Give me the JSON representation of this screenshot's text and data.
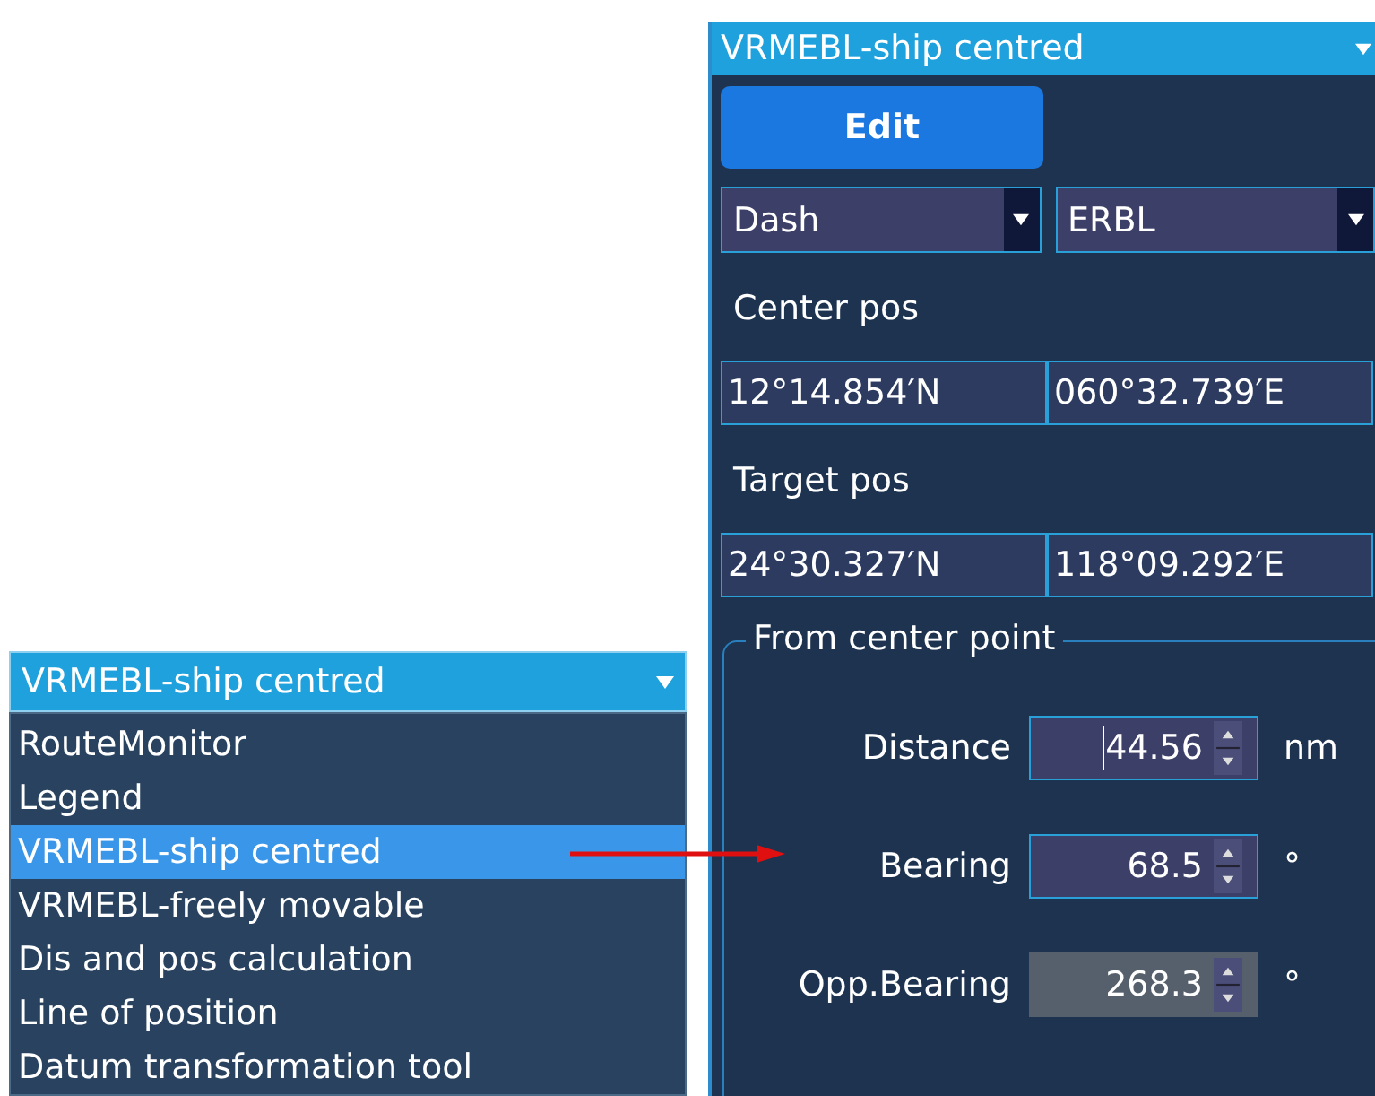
{
  "menu": {
    "value": "VRMEBL-ship centred",
    "options": [
      {
        "label": "RouteMonitor",
        "selected": false
      },
      {
        "label": "Legend",
        "selected": false
      },
      {
        "label": "VRMEBL-ship centred",
        "selected": true
      },
      {
        "label": "VRMEBL-freely movable",
        "selected": false
      },
      {
        "label": "Dis and pos calculation",
        "selected": false
      },
      {
        "label": "Line of position",
        "selected": false
      },
      {
        "label": "Datum transformation tool",
        "selected": false
      }
    ]
  },
  "panel": {
    "title": "VRMEBL-ship centred",
    "edit_button": "Edit",
    "selects": [
      {
        "value": "Dash"
      },
      {
        "value": "ERBL"
      }
    ],
    "positions": [
      {
        "label": "Center pos",
        "lat": "12°14.854′N",
        "lon": "060°32.739′E"
      },
      {
        "label": "Target pos",
        "lat": "24°30.327′N",
        "lon": "118°09.292′E"
      }
    ],
    "group": {
      "legend": "From center point",
      "rows": [
        {
          "label": "Distance",
          "value": "44.56",
          "unit": "nm",
          "focused": true,
          "disabled": false
        },
        {
          "label": "Bearing",
          "value": "68.5",
          "unit": "°",
          "focused": false,
          "disabled": false
        },
        {
          "label": "Opp.Bearing",
          "value": "268.3",
          "unit": "°",
          "focused": false,
          "disabled": true
        }
      ]
    }
  }
}
